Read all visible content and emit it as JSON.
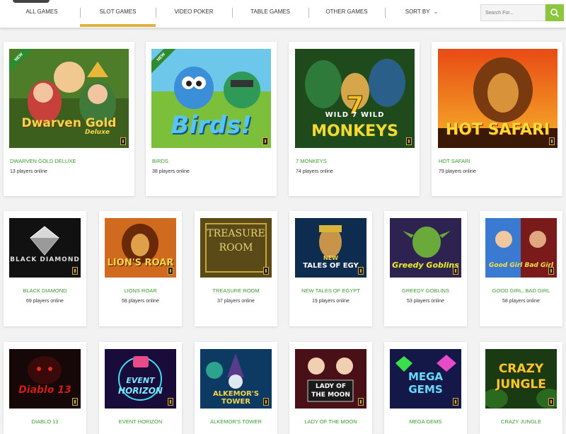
{
  "nav": {
    "items": [
      {
        "label": "ALL GAMES"
      },
      {
        "label": "SLOT GAMES"
      },
      {
        "label": "VIDEO POKER"
      },
      {
        "label": "TABLE GAMES"
      },
      {
        "label": "OTHER GAMES"
      },
      {
        "label": "SORT BY"
      }
    ],
    "active_index": 1,
    "search_placeholder": "Search For..."
  },
  "badges": {
    "new": "NEW"
  },
  "featured": [
    {
      "title": "DWARVEN GOLD DELUXE",
      "players": "13 players online",
      "logo": "Dwarven Gold",
      "logo2": "Deluxe"
    },
    {
      "title": "BIRDS",
      "players": "38 players online",
      "logo": "Birds!"
    },
    {
      "title": "7 MONKEYS",
      "players": "74 players online",
      "logo": "WILD 7 WILD",
      "logo2": "MONKEYS"
    },
    {
      "title": "HOT SAFARI",
      "players": "79 players online",
      "logo": "HOT SAFARI"
    }
  ],
  "row2": [
    {
      "title": "BLACK DIAMOND",
      "players": "69 players online",
      "logo": "BLACK DIAMOND"
    },
    {
      "title": "LIONS ROAR",
      "players": "58 players online",
      "logo": "LION'S ROAR"
    },
    {
      "title": "TREASURE ROOM",
      "players": "37 players online",
      "logo": "TREASURE",
      "logo2": "ROOM"
    },
    {
      "title": "NEW TALES OF EGYPT",
      "players": "19 players online",
      "logo": "TALES OF EGY",
      "logo2": "NEW"
    },
    {
      "title": "GREEDY GOBLINS",
      "players": "53 players online",
      "logo": "Greedy Goblins"
    },
    {
      "title": "GOOD GIRL, BAD GIRL",
      "players": "58 players online",
      "logo": "Good Girl  Bad Girl"
    }
  ],
  "row3": [
    {
      "title": "DIABLO 13",
      "logo": "Diablo 13"
    },
    {
      "title": "EVENT HORIZON",
      "logo": "EVENT",
      "logo2": "HORIZON"
    },
    {
      "title": "ALKEMOR'S TOWER",
      "logo": "ALKEMOR'S TOWER"
    },
    {
      "title": "LADY OF THE MOON",
      "logo": "LADY OF",
      "logo2": "THE MOON"
    },
    {
      "title": "MEGA GEMS",
      "logo": "MEGA",
      "logo2": "GEMS"
    },
    {
      "title": "CRAZY JUNGLE",
      "logo": "CRAZY",
      "logo2": "JUNGLE"
    }
  ],
  "colors": {
    "accent_green": "#3b9a2f",
    "active_underline": "#e0b43c",
    "search_button": "#8cc63f"
  }
}
